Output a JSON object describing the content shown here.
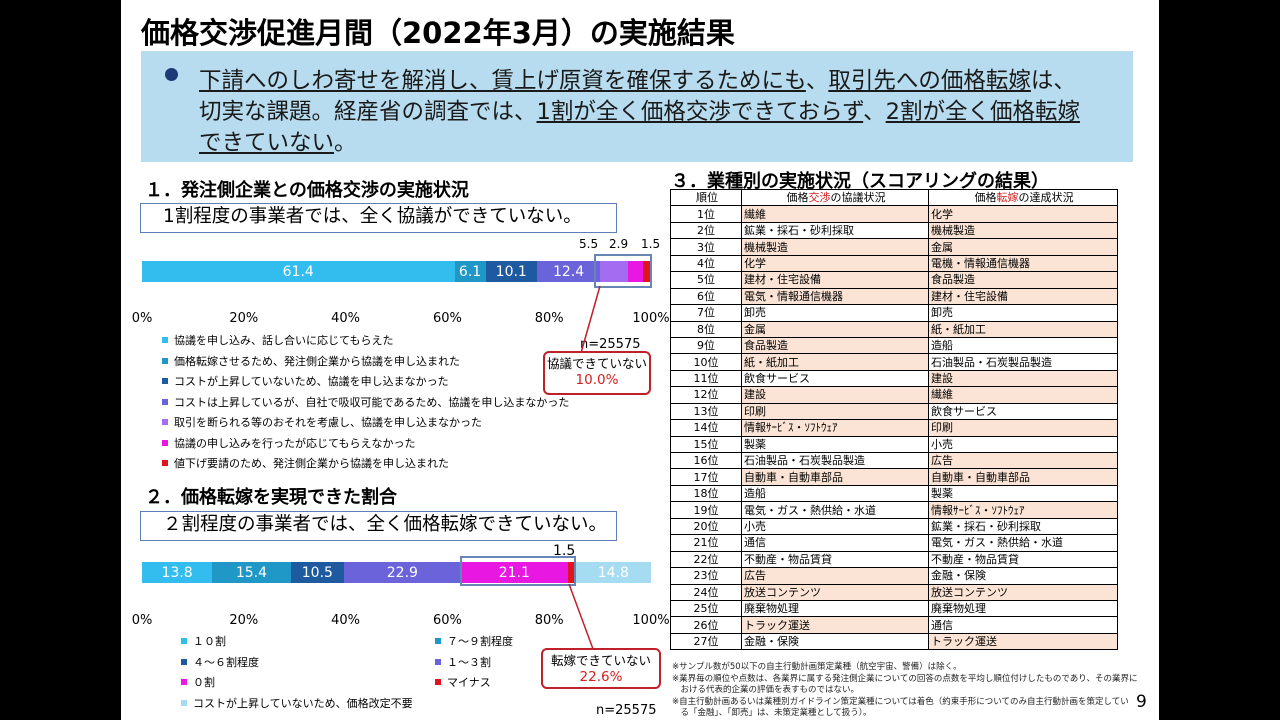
{
  "title": "価格交渉促進月間（2022年3月）の実施結果",
  "summary": {
    "line1": [
      {
        "text": "下請へのしわ寄せを解消し、",
        "u": true
      },
      {
        "text": "賃上げ原資を確保するためにも",
        "u": true
      },
      {
        "text": "、",
        "u": false
      },
      {
        "text": "取引先への価格転嫁",
        "u": true
      },
      {
        "text": "は、",
        "u": false
      }
    ],
    "line2": [
      {
        "text": "切実な課題。経産省の調査では、",
        "u": false
      },
      {
        "text": "1割が全く価格交渉できておらず",
        "u": true
      },
      {
        "text": "、",
        "u": false
      },
      {
        "text": "2割が全く価格転嫁",
        "u": true
      }
    ],
    "line3": [
      {
        "text": "できていない",
        "u": true
      },
      {
        "text": "。",
        "u": false
      }
    ]
  },
  "section1": {
    "title": "１．発注側企業との価格交渉の実施状況",
    "callout": "1割程度の事業者では、全く協議ができていない。",
    "segments": [
      {
        "value": 61.4,
        "label": "61.4",
        "color": "#33bdef"
      },
      {
        "value": 6.1,
        "label": "6.1",
        "color": "#1f97c7"
      },
      {
        "value": 10.1,
        "label": "10.1",
        "color": "#1e5a9f"
      },
      {
        "value": 12.4,
        "label": "12.4",
        "color": "#6a63d9"
      },
      {
        "value": 5.5,
        "label": "",
        "color": "#a46cf0"
      },
      {
        "value": 2.9,
        "label": "",
        "color": "#e817e2"
      },
      {
        "value": 1.5,
        "label": "",
        "color": "#e0141e"
      }
    ],
    "over_labels": [
      "5.5",
      "2.9",
      "1.5"
    ],
    "axis": [
      "0%",
      "20%",
      "40%",
      "60%",
      "80%",
      "100%"
    ],
    "n": "n=25575",
    "legend": [
      {
        "label": "協議を申し込み、話し合いに応じてもらえた",
        "color": "#33bdef"
      },
      {
        "label": "価格転嫁させるため、発注側企業から協議を申し込まれた",
        "color": "#1f97c7"
      },
      {
        "label": "コストが上昇していないため、協議を申し込まなかった",
        "color": "#1e5a9f"
      },
      {
        "label": "コストは上昇しているが、自社で吸収可能であるため、協議を申し込まなかった",
        "color": "#6a63d9"
      },
      {
        "label": "取引を断られる等のおそれを考慮し、協議を申し込まなかった",
        "color": "#a46cf0"
      },
      {
        "label": "協議の申し込みを行ったが応じてもらえなかった",
        "color": "#e817e2"
      },
      {
        "label": "値下げ要請のため、発注側企業から協議を申し込まれた",
        "color": "#e0141e"
      }
    ],
    "redbox": {
      "line1": "協議できていない",
      "line2": "10.0%"
    }
  },
  "section2": {
    "title": "２．価格転嫁を実現できた割合",
    "callout": "２割程度の事業者では、全く価格転嫁できていない。",
    "segments": [
      {
        "value": 13.8,
        "label": "13.8",
        "color": "#33bdef"
      },
      {
        "value": 15.4,
        "label": "15.4",
        "color": "#1f97c7"
      },
      {
        "value": 10.5,
        "label": "10.5",
        "color": "#1e5a9f"
      },
      {
        "value": 22.9,
        "label": "22.9",
        "color": "#6a63d9"
      },
      {
        "value": 21.1,
        "label": "21.1",
        "color": "#e817e2"
      },
      {
        "value": 1.5,
        "label": "",
        "color": "#e0141e"
      },
      {
        "value": 14.8,
        "label": "14.8",
        "color": "#a6dcf2"
      }
    ],
    "over_label": "1.5",
    "axis": [
      "0%",
      "20%",
      "40%",
      "60%",
      "80%",
      "100%"
    ],
    "n": "n=25575",
    "legend": [
      {
        "label": "１０割",
        "color": "#33bdef"
      },
      {
        "label": "７～９割程度",
        "color": "#1f97c7"
      },
      {
        "label": "４～６割程度",
        "color": "#1e5a9f"
      },
      {
        "label": "１～３割",
        "color": "#6a63d9"
      },
      {
        "label": "０割",
        "color": "#e817e2"
      },
      {
        "label": "マイナス",
        "color": "#e0141e"
      },
      {
        "label": "コストが上昇していないため、価格改定不要",
        "color": "#a6dcf2"
      }
    ],
    "redbox": {
      "line1": "転嫁できていない",
      "line2": "22.6%"
    }
  },
  "section3": {
    "title": "３．業種別の実施状況（スコアリングの結果）",
    "headers": {
      "rank": "順位",
      "col1_pre": "価格",
      "col1_red": "交渉",
      "col1_post": "の協議状況",
      "col2_pre": "価格",
      "col2_red": "転嫁",
      "col2_post": "の達成状況"
    },
    "rows": [
      {
        "rank": "1位",
        "a": "繊維",
        "b": "化学",
        "ah": true,
        "bh": true
      },
      {
        "rank": "2位",
        "a": "鉱業・採石・砂利採取",
        "b": "機械製造",
        "ah": false,
        "bh": true
      },
      {
        "rank": "3位",
        "a": "機械製造",
        "b": "金属",
        "ah": true,
        "bh": true
      },
      {
        "rank": "4位",
        "a": "化学",
        "b": "電機・情報通信機器",
        "ah": true,
        "bh": true
      },
      {
        "rank": "5位",
        "a": "建材・住宅設備",
        "b": "食品製造",
        "ah": true,
        "bh": true
      },
      {
        "rank": "6位",
        "a": "電気・情報通信機器",
        "b": "建材・住宅設備",
        "ah": true,
        "bh": true
      },
      {
        "rank": "7位",
        "a": "卸売",
        "b": "卸売",
        "ah": false,
        "bh": false
      },
      {
        "rank": "8位",
        "a": "金属",
        "b": "紙・紙加工",
        "ah": true,
        "bh": true
      },
      {
        "rank": "9位",
        "a": "食品製造",
        "b": "造船",
        "ah": true,
        "bh": false
      },
      {
        "rank": "10位",
        "a": "紙・紙加工",
        "b": "石油製品・石炭製品製造",
        "ah": true,
        "bh": false
      },
      {
        "rank": "11位",
        "a": "飲食サービス",
        "b": "建設",
        "ah": false,
        "bh": true
      },
      {
        "rank": "12位",
        "a": "建設",
        "b": "繊維",
        "ah": true,
        "bh": true
      },
      {
        "rank": "13位",
        "a": "印刷",
        "b": "飲食サービス",
        "ah": true,
        "bh": false
      },
      {
        "rank": "14位",
        "a": "情報ｻｰﾋﾞｽ・ｿﾌﾄｳｪｱ",
        "b": "印刷",
        "ah": true,
        "bh": true
      },
      {
        "rank": "15位",
        "a": "製薬",
        "b": "小売",
        "ah": false,
        "bh": false
      },
      {
        "rank": "16位",
        "a": "石油製品・石炭製品製造",
        "b": "広告",
        "ah": false,
        "bh": true
      },
      {
        "rank": "17位",
        "a": "自動車・自動車部品",
        "b": "自動車・自動車部品",
        "ah": true,
        "bh": true
      },
      {
        "rank": "18位",
        "a": "造船",
        "b": "製薬",
        "ah": false,
        "bh": false
      },
      {
        "rank": "19位",
        "a": "電気・ガス・熱供給・水道",
        "b": "情報ｻｰﾋﾞｽ・ｿﾌﾄｳｪｱ",
        "ah": false,
        "bh": true
      },
      {
        "rank": "20位",
        "a": "小売",
        "b": "鉱業・採石・砂利採取",
        "ah": false,
        "bh": false
      },
      {
        "rank": "21位",
        "a": "通信",
        "b": "電気・ガス・熱供給・水道",
        "ah": false,
        "bh": false
      },
      {
        "rank": "22位",
        "a": "不動産・物品賃貸",
        "b": "不動産・物品賃貸",
        "ah": false,
        "bh": false
      },
      {
        "rank": "23位",
        "a": "広告",
        "b": "金融・保険",
        "ah": true,
        "bh": false
      },
      {
        "rank": "24位",
        "a": "放送コンテンツ",
        "b": "放送コンテンツ",
        "ah": true,
        "bh": true
      },
      {
        "rank": "25位",
        "a": "廃棄物処理",
        "b": "廃棄物処理",
        "ah": false,
        "bh": false
      },
      {
        "rank": "26位",
        "a": "トラック運送",
        "b": "通信",
        "ah": true,
        "bh": false
      },
      {
        "rank": "27位",
        "a": "金融・保険",
        "b": "トラック運送",
        "ah": false,
        "bh": true
      }
    ],
    "notes": [
      "※サンプル数が50以下の自主行動計画策定業種（航空宇宙、警備）は除く。",
      "※業界毎の順位や点数は、各業界に属する発注側企業についての回答の点数を平均し順位付けしたものであり、その業界に",
      "　おける代表的企業の評価を表すものではない。",
      "※自主行動計画あるいは業種別ガイドライン策定業種については着色（約束手形についてのみ自主行動計画を策定してい",
      "　る「金融」、「卸売」は、未策定業種として扱う）。"
    ]
  },
  "page_number": "9"
}
